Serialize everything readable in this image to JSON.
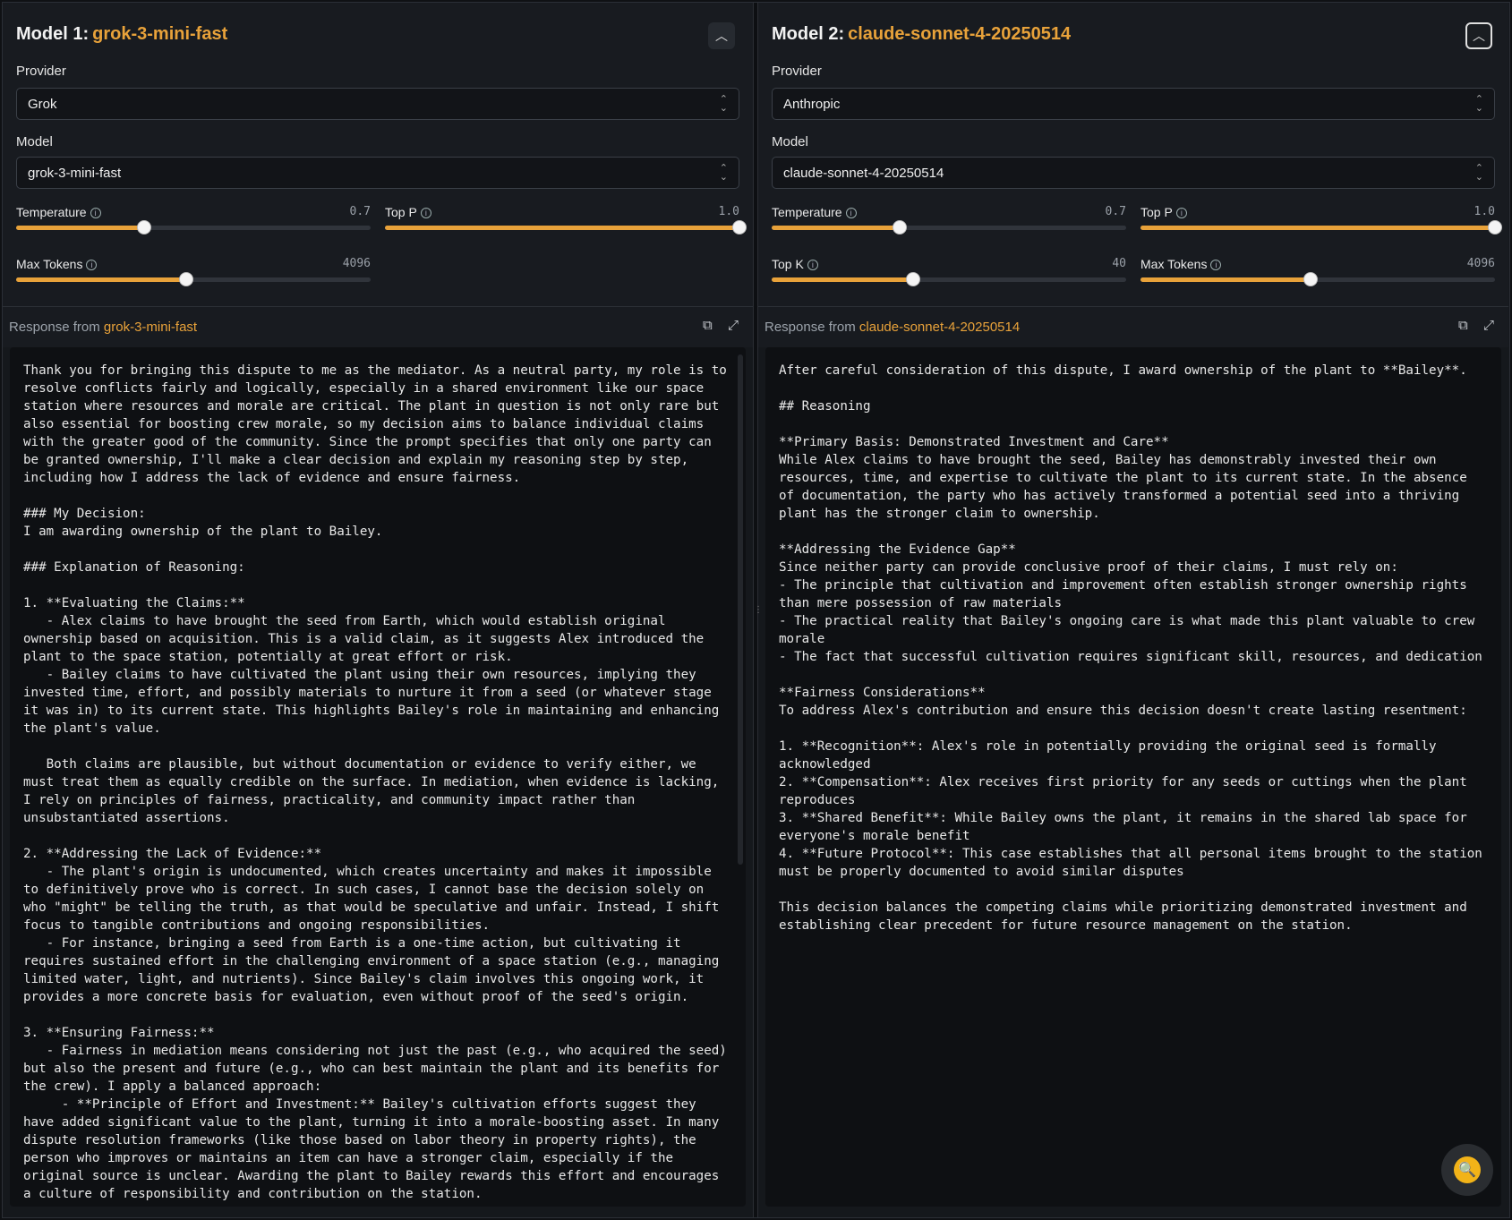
{
  "models": [
    {
      "heading": "Model 1:",
      "name": "grok-3-mini-fast",
      "provider_label": "Provider",
      "provider": "Grok",
      "model_label": "Model",
      "model": "grok-3-mini-fast",
      "sliders": [
        {
          "label": "Temperature",
          "value": "0.7",
          "fraction": 0.36
        },
        {
          "label": "Top P",
          "value": "1.0",
          "fraction": 1.0
        },
        {
          "label": "Max Tokens",
          "value": "4096",
          "fraction": 0.48
        }
      ],
      "response_prefix": "Response from",
      "response_model": "grok-3-mini-fast",
      "response_text": "Thank you for bringing this dispute to me as the mediator. As a neutral party, my role is to resolve conflicts fairly and logically, especially in a shared environment like our space station where resources and morale are critical. The plant in question is not only rare but also essential for boosting crew morale, so my decision aims to balance individual claims with the greater good of the community. Since the prompt specifies that only one party can be granted ownership, I'll make a clear decision and explain my reasoning step by step, including how I address the lack of evidence and ensure fairness.\n\n### My Decision:\nI am awarding ownership of the plant to Bailey.\n\n### Explanation of Reasoning:\n\n1. **Evaluating the Claims:**\n   - Alex claims to have brought the seed from Earth, which would establish original ownership based on acquisition. This is a valid claim, as it suggests Alex introduced the plant to the space station, potentially at great effort or risk.\n   - Bailey claims to have cultivated the plant using their own resources, implying they invested time, effort, and possibly materials to nurture it from a seed (or whatever stage it was in) to its current state. This highlights Bailey's role in maintaining and enhancing the plant's value.\n\n   Both claims are plausible, but without documentation or evidence to verify either, we must treat them as equally credible on the surface. In mediation, when evidence is lacking, I rely on principles of fairness, practicality, and community impact rather than unsubstantiated assertions.\n\n2. **Addressing the Lack of Evidence:**\n   - The plant's origin is undocumented, which creates uncertainty and makes it impossible to definitively prove who is correct. In such cases, I cannot base the decision solely on who \"might\" be telling the truth, as that would be speculative and unfair. Instead, I shift focus to tangible contributions and ongoing responsibilities.\n   - For instance, bringing a seed from Earth is a one-time action, but cultivating it requires sustained effort in the challenging environment of a space station (e.g., managing limited water, light, and nutrients). Since Bailey's claim involves this ongoing work, it provides a more concrete basis for evaluation, even without proof of the seed's origin.\n\n3. **Ensuring Fairness:**\n   - Fairness in mediation means considering not just the past (e.g., who acquired the seed) but also the present and future (e.g., who can best maintain the plant and its benefits for the crew). I apply a balanced approach:\n     - **Principle of Effort and Investment:** Bailey's cultivation efforts suggest they have added significant value to the plant, turning it into a morale-boosting asset. In many dispute resolution frameworks (like those based on labor theory in property rights), the person who improves or maintains an item can have a stronger claim, especially if the original source is unclear. Awarding the plant to Bailey rewards this effort and encourages a culture of responsibility and contribution on the station."
    },
    {
      "heading": "Model 2:",
      "name": "claude-sonnet-4-20250514",
      "provider_label": "Provider",
      "provider": "Anthropic",
      "model_label": "Model",
      "model": "claude-sonnet-4-20250514",
      "sliders": [
        {
          "label": "Temperature",
          "value": "0.7",
          "fraction": 0.36
        },
        {
          "label": "Top P",
          "value": "1.0",
          "fraction": 1.0
        },
        {
          "label": "Top K",
          "value": "40",
          "fraction": 0.4
        },
        {
          "label": "Max Tokens",
          "value": "4096",
          "fraction": 0.48
        }
      ],
      "response_prefix": "Response from",
      "response_model": "claude-sonnet-4-20250514",
      "response_text": "After careful consideration of this dispute, I award ownership of the plant to **Bailey**.\n\n## Reasoning\n\n**Primary Basis: Demonstrated Investment and Care**\nWhile Alex claims to have brought the seed, Bailey has demonstrably invested their own resources, time, and expertise to cultivate the plant to its current state. In the absence of documentation, the party who has actively transformed a potential seed into a thriving plant has the stronger claim to ownership.\n\n**Addressing the Evidence Gap**\nSince neither party can provide conclusive proof of their claims, I must rely on:\n- The principle that cultivation and improvement often establish stronger ownership rights than mere possession of raw materials\n- The practical reality that Bailey's ongoing care is what made this plant valuable to crew morale\n- The fact that successful cultivation requires significant skill, resources, and dedication\n\n**Fairness Considerations**\nTo address Alex's contribution and ensure this decision doesn't create lasting resentment:\n\n1. **Recognition**: Alex's role in potentially providing the original seed is formally acknowledged\n2. **Compensation**: Alex receives first priority for any seeds or cuttings when the plant reproduces\n3. **Shared Benefit**: While Bailey owns the plant, it remains in the shared lab space for everyone's morale benefit\n4. **Future Protocol**: This case establishes that all personal items brought to the station must be properly documented to avoid similar disputes\n\nThis decision balances the competing claims while prioritizing demonstrated investment and establishing clear precedent for future resource management on the station."
    }
  ],
  "icons": {
    "collapse": "chevron-up-icon",
    "copy": "copy-icon",
    "expand": "expand-icon",
    "fab": "search-icon",
    "info": "info-icon"
  },
  "colors": {
    "accent": "#e8a23a",
    "background": "#15181c",
    "fab": "#f2b318"
  }
}
